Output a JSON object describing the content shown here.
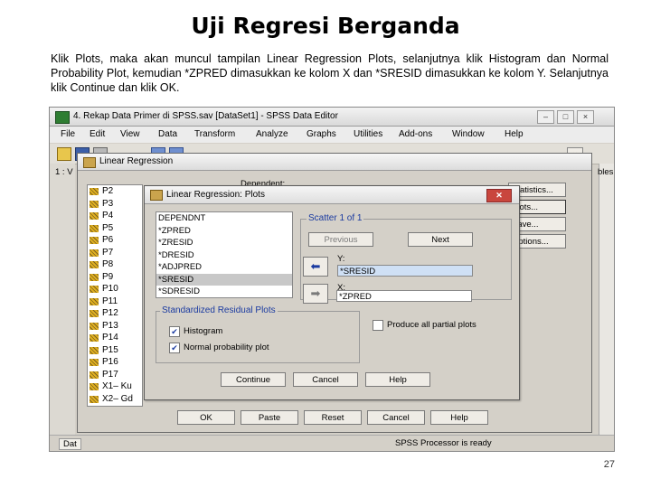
{
  "slide": {
    "title": "Uji Regresi Berganda",
    "paragraph": "Klik Plots, maka akan muncul tampilan Linear Regression Plots, selanjutnya klik Histogram dan Normal Probability Plot, kemudian *ZPRED dimasukkan ke kolom X dan *SRESID dimasukkan ke kolom Y. Selanjutnya klik Continue dan klik OK.",
    "page_number": "27"
  },
  "window": {
    "title": "4. Rekap Data Primer di SPSS.sav [DataSet1]  -  SPSS Data Editor",
    "menu": [
      "File",
      "Edit",
      "View",
      "Data",
      "Transform",
      "Analyze",
      "Graphs",
      "Utilities",
      "Add-ons",
      "Window",
      "Help"
    ],
    "status": "SPSS  Processor is ready"
  },
  "lr_dialog": {
    "title": "Linear Regression",
    "dependent_label": "Dependent:",
    "variables": [
      "P2",
      "P3",
      "P4",
      "P5",
      "P6",
      "P7",
      "P8",
      "P9",
      "P10",
      "P11",
      "P12",
      "P13",
      "P14",
      "P15",
      "P16",
      "P17",
      "X1– Ku",
      "X2– Gd"
    ],
    "side_buttons": [
      "Statistics...",
      "Plots...",
      "Save...",
      "Options..."
    ],
    "bottom_buttons": [
      "OK",
      "Paste",
      "Reset",
      "Cancel",
      "Help"
    ],
    "cut_text_right": "bles"
  },
  "plots_dialog": {
    "title": "Linear Regression: Plots",
    "source_list": [
      "DEPENDNT",
      "*ZPRED",
      "*ZRESID",
      "*DRESID",
      "*ADJPRED",
      "*SRESID",
      "*SDRESID"
    ],
    "selected_source": "*SRESID",
    "scatter_legend": "Scatter 1 of 1",
    "previous_label": "Previous",
    "next_label": "Next",
    "y_label": "Y:",
    "y_value": "*SRESID",
    "x_label": "X:",
    "x_value": "*ZPRED",
    "std_legend": "Standardized Residual Plots",
    "histogram_label": "Histogram",
    "histogram_checked": true,
    "normal_label": "Normal probability plot",
    "normal_checked": true,
    "partial_label": "Produce all partial plots",
    "partial_checked": false,
    "buttons": [
      "Continue",
      "Cancel",
      "Help"
    ]
  }
}
